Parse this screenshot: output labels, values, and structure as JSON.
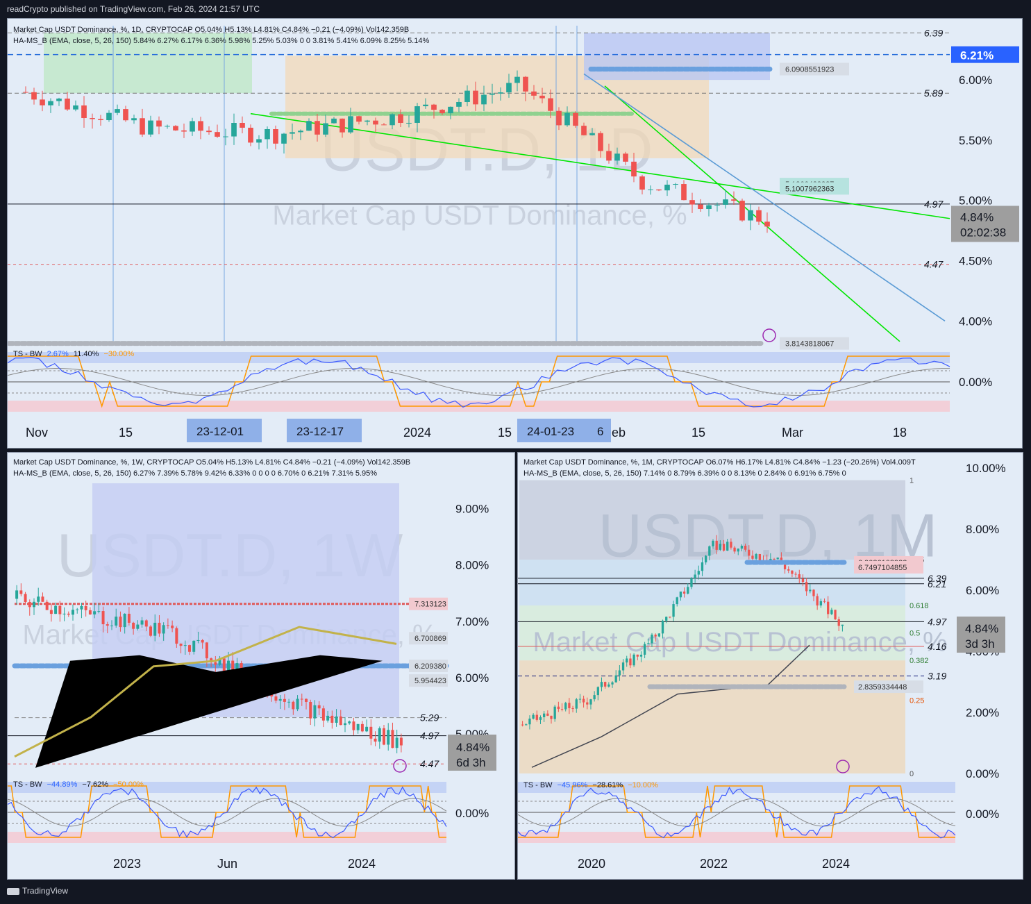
{
  "header": {
    "text": "readCrypto published on TradingView.com, Feb 26, 2024 21:57 UTC"
  },
  "footer": {
    "brand": "TradingView"
  },
  "colors": {
    "panel_bg": "#e3ecf7",
    "up": "#26a69a",
    "down": "#ef5350",
    "green_line": "#00e600",
    "blue_line": "#5b9bd5",
    "orange": "#ff9800",
    "dark": "#434651",
    "price_label": "#9e9e9e",
    "current_badge": "#2962ff"
  },
  "panels": {
    "daily": {
      "watermark_ticker": "USDT.D, 1D",
      "watermark_name": "Market Cap USDT Dominance, %",
      "legend1": "Market Cap USDT Dominance, %, 1D, CRYPTOCAP  O5.04%  H5.13%  L4.81%  C4.84%  −0.21 (−4.09%)  Vol142.359B",
      "legend2": "HA-MS_B (EMA, close, 5, 26, 150)  5.84%  6.27%  6.17%  6.36%  5.98%  5.25%  5.03%  0  0  3.81%  5.41%  6.09%  8.25%  5.14%",
      "osc_legend": "TS - BW",
      "osc_values": [
        "2.67%",
        "11.40%",
        "−30.00%"
      ],
      "osc_zero_label": "0.00%",
      "y_ticks": [
        "6.00%",
        "5.50%",
        "5.00%",
        "4.50%",
        "4.00%"
      ],
      "level_labels": [
        "6.39",
        "5.89",
        "4.97",
        "4.47"
      ],
      "current_level": "6.21%",
      "price_tags": [
        "6.0908551923",
        "5.1366428387",
        "5.1007962363",
        "3.8143818067"
      ],
      "last_price": "4.84%",
      "countdown": "02:02:38",
      "x_labels": [
        "Nov",
        "15",
        "2024",
        "15",
        "eb",
        "15",
        "Mar",
        "18"
      ],
      "date_badges": [
        "23-12-01",
        "23-12-17",
        "24-01-23",
        "6"
      ]
    },
    "weekly": {
      "watermark_ticker": "USDT.D, 1W",
      "watermark_name": "Market Cap USDT Dominance, %",
      "legend1": "Market Cap USDT Dominance, %, 1W, CRYPTOCAP  O5.04%  H5.13%  L4.81%  C4.84%  −0.21 (−4.09%)  Vol142.359B",
      "legend2": "HA-MS_B (EMA, close, 5, 26, 150)  6.27%  7.39%  5.78%  9.42%  6.33%  0  0  0  0  6.70%  0  6.21%  7.31%  5.95%",
      "osc_legend": "TS - BW",
      "osc_values": [
        "−44.89%",
        "−7.62%",
        "−50.00%"
      ],
      "osc_zero_label": "0.00%",
      "y_ticks": [
        "9.00%",
        "8.00%",
        "7.00%",
        "6.00%",
        "5.00%"
      ],
      "level_labels": [
        "5.29",
        "4.97",
        "4.47"
      ],
      "price_tags": [
        "7.313123",
        "6.700869",
        "6.209380",
        "5.954423"
      ],
      "last_price": "4.84%",
      "countdown": "6d 3h",
      "x_labels": [
        "2023",
        "Jun",
        "2024"
      ]
    },
    "monthly": {
      "watermark_ticker": "USDT.D, 1M",
      "watermark_name": "Market Cap USDT Dominance, %",
      "legend1": "Market Cap USDT Dominance, %, 1M, CRYPTOCAP  O6.07%  H6.17%  L4.81%  C4.84%  −1.23 (−20.26%)  Vol4.009T",
      "legend2": "HA-MS_B (EMA, close, 5, 26, 150)  7.14%  0  8.79%  6.39%  0  0  8.13%  0  2.84%  0  6.91%  6.75%  0",
      "osc_legend": "TS - BW",
      "osc_values": [
        "−45.96%",
        "−28.61%",
        "−10.00%"
      ],
      "osc_zero_label": "0.00%",
      "y_ticks": [
        "10.00%",
        "8.00%",
        "6.00%",
        "4.00%",
        "2.00%",
        "0.00%"
      ],
      "level_labels": [
        "6.39",
        "6.21",
        "4.97",
        "4.16",
        "3.19"
      ],
      "fib_labels": [
        "1",
        "0.75",
        "0.618",
        "0.5",
        "0.382",
        "0.25",
        "0"
      ],
      "price_tags": [
        "6.9086108922",
        "6.7497104855",
        "2.8359334448"
      ],
      "last_price": "4.84%",
      "countdown": "3d 3h",
      "x_labels": [
        "2020",
        "2022",
        "2024"
      ]
    }
  },
  "chart_data": [
    {
      "type": "line",
      "title": "Market Cap USDT Dominance, %, 1D, CRYPTOCAP",
      "ylim": [
        3.8,
        6.45
      ],
      "x": [
        "Nov",
        "15",
        "2024",
        "15",
        "eb",
        "15",
        "Mar"
      ],
      "series": [
        {
          "name": "",
          "values": [
            5.9,
            5.6,
            5.55,
            5.7,
            5.95,
            5.15,
            4.84
          ]
        }
      ],
      "levels": [
        6.39,
        6.21,
        5.89,
        4.97,
        4.47
      ],
      "ohlc_last": {
        "open": 5.04,
        "high": 5.13,
        "low": 4.81,
        "close": 4.84
      }
    },
    {
      "type": "line",
      "title": "Market Cap USDT Dominance, %, 1W, CRYPTOCAP",
      "ylim": [
        4.3,
        9.5
      ],
      "x": [
        "2023",
        "Jun",
        "2024"
      ],
      "series": [
        {
          "name": "",
          "values": [
            7.4,
            7.1,
            6.8,
            6.0,
            5.3,
            4.84
          ]
        }
      ],
      "levels": [
        5.29,
        4.97,
        4.47
      ]
    },
    {
      "type": "line",
      "title": "Market Cap USDT Dominance, %, 1M, CRYPTOCAP",
      "ylim": [
        0,
        10
      ],
      "x": [
        "2020",
        "2022",
        "2024"
      ],
      "series": [
        {
          "name": "",
          "values": [
            1.6,
            2.4,
            4.3,
            7.5,
            7.0,
            4.84
          ]
        }
      ],
      "levels": [
        6.39,
        6.21,
        4.97,
        4.16,
        3.19
      ]
    }
  ]
}
